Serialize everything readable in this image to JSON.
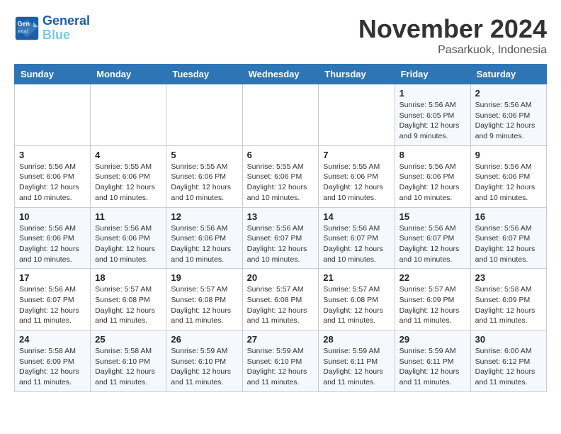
{
  "header": {
    "logo_line1": "General",
    "logo_line2": "Blue",
    "month": "November 2024",
    "location": "Pasarkuok, Indonesia"
  },
  "weekdays": [
    "Sunday",
    "Monday",
    "Tuesday",
    "Wednesday",
    "Thursday",
    "Friday",
    "Saturday"
  ],
  "weeks": [
    [
      {
        "day": "",
        "info": ""
      },
      {
        "day": "",
        "info": ""
      },
      {
        "day": "",
        "info": ""
      },
      {
        "day": "",
        "info": ""
      },
      {
        "day": "",
        "info": ""
      },
      {
        "day": "1",
        "info": "Sunrise: 5:56 AM\nSunset: 6:05 PM\nDaylight: 12 hours and 9 minutes."
      },
      {
        "day": "2",
        "info": "Sunrise: 5:56 AM\nSunset: 6:06 PM\nDaylight: 12 hours and 9 minutes."
      }
    ],
    [
      {
        "day": "3",
        "info": "Sunrise: 5:56 AM\nSunset: 6:06 PM\nDaylight: 12 hours and 10 minutes."
      },
      {
        "day": "4",
        "info": "Sunrise: 5:55 AM\nSunset: 6:06 PM\nDaylight: 12 hours and 10 minutes."
      },
      {
        "day": "5",
        "info": "Sunrise: 5:55 AM\nSunset: 6:06 PM\nDaylight: 12 hours and 10 minutes."
      },
      {
        "day": "6",
        "info": "Sunrise: 5:55 AM\nSunset: 6:06 PM\nDaylight: 12 hours and 10 minutes."
      },
      {
        "day": "7",
        "info": "Sunrise: 5:55 AM\nSunset: 6:06 PM\nDaylight: 12 hours and 10 minutes."
      },
      {
        "day": "8",
        "info": "Sunrise: 5:56 AM\nSunset: 6:06 PM\nDaylight: 12 hours and 10 minutes."
      },
      {
        "day": "9",
        "info": "Sunrise: 5:56 AM\nSunset: 6:06 PM\nDaylight: 12 hours and 10 minutes."
      }
    ],
    [
      {
        "day": "10",
        "info": "Sunrise: 5:56 AM\nSunset: 6:06 PM\nDaylight: 12 hours and 10 minutes."
      },
      {
        "day": "11",
        "info": "Sunrise: 5:56 AM\nSunset: 6:06 PM\nDaylight: 12 hours and 10 minutes."
      },
      {
        "day": "12",
        "info": "Sunrise: 5:56 AM\nSunset: 6:06 PM\nDaylight: 12 hours and 10 minutes."
      },
      {
        "day": "13",
        "info": "Sunrise: 5:56 AM\nSunset: 6:07 PM\nDaylight: 12 hours and 10 minutes."
      },
      {
        "day": "14",
        "info": "Sunrise: 5:56 AM\nSunset: 6:07 PM\nDaylight: 12 hours and 10 minutes."
      },
      {
        "day": "15",
        "info": "Sunrise: 5:56 AM\nSunset: 6:07 PM\nDaylight: 12 hours and 10 minutes."
      },
      {
        "day": "16",
        "info": "Sunrise: 5:56 AM\nSunset: 6:07 PM\nDaylight: 12 hours and 10 minutes."
      }
    ],
    [
      {
        "day": "17",
        "info": "Sunrise: 5:56 AM\nSunset: 6:07 PM\nDaylight: 12 hours and 11 minutes."
      },
      {
        "day": "18",
        "info": "Sunrise: 5:57 AM\nSunset: 6:08 PM\nDaylight: 12 hours and 11 minutes."
      },
      {
        "day": "19",
        "info": "Sunrise: 5:57 AM\nSunset: 6:08 PM\nDaylight: 12 hours and 11 minutes."
      },
      {
        "day": "20",
        "info": "Sunrise: 5:57 AM\nSunset: 6:08 PM\nDaylight: 12 hours and 11 minutes."
      },
      {
        "day": "21",
        "info": "Sunrise: 5:57 AM\nSunset: 6:08 PM\nDaylight: 12 hours and 11 minutes."
      },
      {
        "day": "22",
        "info": "Sunrise: 5:57 AM\nSunset: 6:09 PM\nDaylight: 12 hours and 11 minutes."
      },
      {
        "day": "23",
        "info": "Sunrise: 5:58 AM\nSunset: 6:09 PM\nDaylight: 12 hours and 11 minutes."
      }
    ],
    [
      {
        "day": "24",
        "info": "Sunrise: 5:58 AM\nSunset: 6:09 PM\nDaylight: 12 hours and 11 minutes."
      },
      {
        "day": "25",
        "info": "Sunrise: 5:58 AM\nSunset: 6:10 PM\nDaylight: 12 hours and 11 minutes."
      },
      {
        "day": "26",
        "info": "Sunrise: 5:59 AM\nSunset: 6:10 PM\nDaylight: 12 hours and 11 minutes."
      },
      {
        "day": "27",
        "info": "Sunrise: 5:59 AM\nSunset: 6:10 PM\nDaylight: 12 hours and 11 minutes."
      },
      {
        "day": "28",
        "info": "Sunrise: 5:59 AM\nSunset: 6:11 PM\nDaylight: 12 hours and 11 minutes."
      },
      {
        "day": "29",
        "info": "Sunrise: 5:59 AM\nSunset: 6:11 PM\nDaylight: 12 hours and 11 minutes."
      },
      {
        "day": "30",
        "info": "Sunrise: 6:00 AM\nSunset: 6:12 PM\nDaylight: 12 hours and 11 minutes."
      }
    ]
  ]
}
